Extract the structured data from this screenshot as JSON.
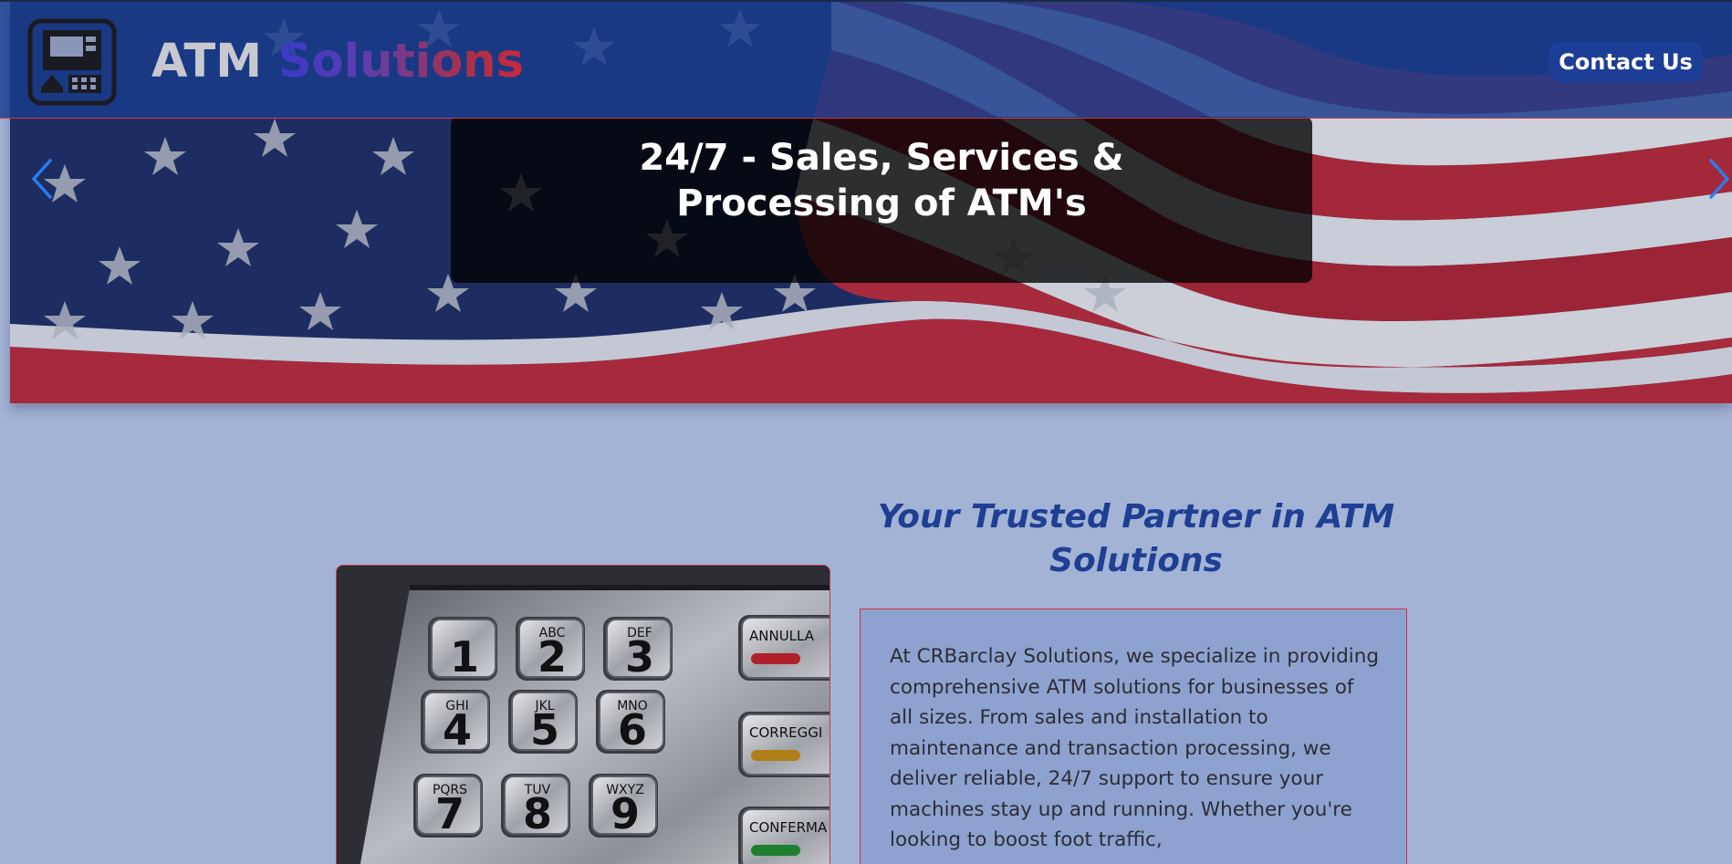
{
  "header": {
    "brand_part1": "ATM ",
    "brand_part2": "Solutions",
    "logo_icon": "atm-machine-icon",
    "contact_label": "Contact Us"
  },
  "hero": {
    "caption": "24/7 - Sales, Services & Processing of ATM's",
    "prev_icon": "chevron-left-icon",
    "next_icon": "chevron-right-icon"
  },
  "main": {
    "title": "Your Trusted Partner in ATM Solutions",
    "body": "At CRBarclay Solutions, we specialize in providing comprehensive ATM solutions for businesses of all sizes. From sales and installation to maintenance and transaction processing, we deliver reliable, 24/7 support to ensure your machines stay up and running. Whether you're looking to boost foot traffic,",
    "keypad": {
      "keys": [
        {
          "digit": "1",
          "letters": ""
        },
        {
          "digit": "2",
          "letters": "ABC"
        },
        {
          "digit": "3",
          "letters": "DEF"
        },
        {
          "digit": "4",
          "letters": "GHI"
        },
        {
          "digit": "5",
          "letters": "JKL"
        },
        {
          "digit": "6",
          "letters": "MNO"
        },
        {
          "digit": "7",
          "letters": "PQRS"
        },
        {
          "digit": "8",
          "letters": "TUV"
        },
        {
          "digit": "9",
          "letters": "WXYZ"
        }
      ],
      "side_keys": [
        "ANNULLA",
        "CORREGGI",
        "CONFERMA"
      ]
    }
  },
  "colors": {
    "page_bg": "#a3b3d6",
    "header_bg": "#193c8c",
    "accent_red": "#c83a4e",
    "title_blue": "#1e3f92",
    "contact_bg": "#1c3e96",
    "carousel_arrow": "#2a7cf0"
  }
}
